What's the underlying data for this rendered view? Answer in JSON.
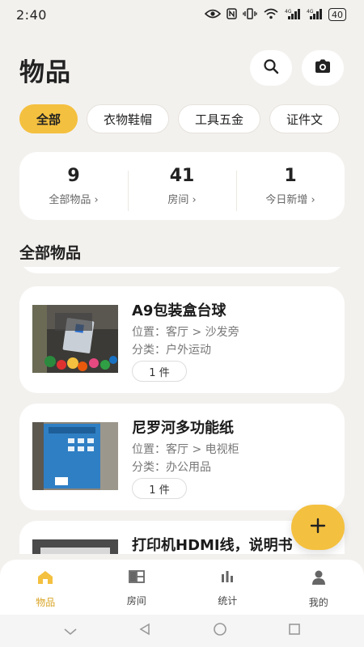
{
  "status": {
    "time": "2:40",
    "battery": "40"
  },
  "header": {
    "title": "物品"
  },
  "categories": [
    {
      "label": "全部",
      "active": true
    },
    {
      "label": "衣物鞋帽",
      "active": false
    },
    {
      "label": "工具五金",
      "active": false
    },
    {
      "label": "证件文",
      "active": false
    }
  ],
  "stats": [
    {
      "value": "9",
      "label": "全部物品 ›"
    },
    {
      "value": "41",
      "label": "房间 ›"
    },
    {
      "value": "1",
      "label": "今日新增 ›"
    }
  ],
  "section": {
    "title": "全部物品"
  },
  "items": [
    {
      "title": "A9包装盒台球",
      "location": "位置：客厅 > 沙发旁",
      "category": "分类：户外运动",
      "qty": "1 件"
    },
    {
      "title": "尼罗河多功能纸",
      "location": "位置：客厅 > 电视柜",
      "category": "分类：办公用品",
      "qty": "1 件"
    },
    {
      "title": "打印机HDMI线，说明书"
    }
  ],
  "tabs": [
    {
      "label": "物品",
      "icon": "home-icon",
      "active": true
    },
    {
      "label": "房间",
      "icon": "room-icon",
      "active": false
    },
    {
      "label": "统计",
      "icon": "chart-icon",
      "active": false
    },
    {
      "label": "我的",
      "icon": "user-icon",
      "active": false
    }
  ],
  "colors": {
    "accent": "#f4c03f",
    "background": "#f3f1ee",
    "active_tab": "#d9a425"
  }
}
